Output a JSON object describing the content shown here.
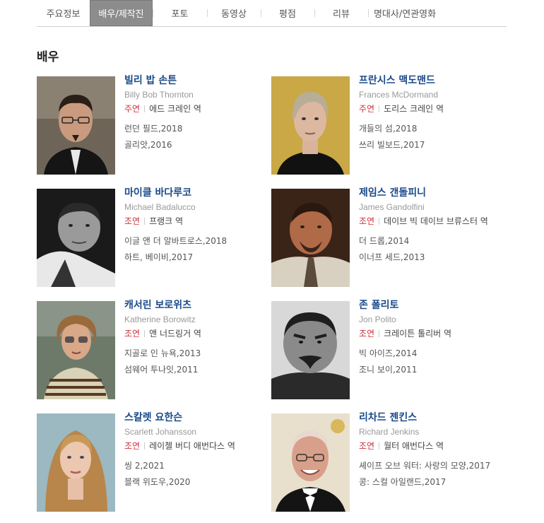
{
  "tabs": [
    {
      "label": "주요정보",
      "active": false
    },
    {
      "label": "배우/제작진",
      "active": true
    },
    {
      "label": "포토",
      "active": false
    },
    {
      "label": "동영상",
      "active": false
    },
    {
      "label": "평점",
      "active": false
    },
    {
      "label": "리뷰",
      "active": false
    },
    {
      "label": "명대사/연관영화",
      "active": false
    }
  ],
  "section_title": "배우",
  "actors": [
    {
      "name_ko": "빌리 밥 손튼",
      "name_en": "Billy Bob Thornton",
      "role": "주연",
      "character": "에드 크레인 역",
      "works": [
        "런던 필드,2018",
        "골리앗,2016"
      ],
      "photo": "portrait-billy-bob-thornton"
    },
    {
      "name_ko": "프란시스 맥도맨드",
      "name_en": "Frances McDormand",
      "role": "주연",
      "character": "도리스 크레인 역",
      "works": [
        "개들의 섬,2018",
        "쓰리 빌보드,2017"
      ],
      "photo": "portrait-frances-mcdormand"
    },
    {
      "name_ko": "마이클 바다루코",
      "name_en": "Michael Badalucco",
      "role": "조연",
      "character": "프랭크 역",
      "works": [
        "이글 앤 더 알바트로스,2018",
        "하트, 베이비,2017"
      ],
      "photo": "portrait-michael-badalucco"
    },
    {
      "name_ko": "제임스 갠돌피니",
      "name_en": "James Gandolfini",
      "role": "조연",
      "character": "데이브 빅 데이브 브류스터 역",
      "works": [
        "더 드롭,2014",
        "이너프 세드,2013"
      ],
      "photo": "portrait-james-gandolfini"
    },
    {
      "name_ko": "캐서린 보로위츠",
      "name_en": "Katherine Borowitz",
      "role": "조연",
      "character": "앤 너드링거 역",
      "works": [
        "지골로 인 뉴욕,2013",
        "섬웨어 투나잇,2011"
      ],
      "photo": "portrait-katherine-borowitz"
    },
    {
      "name_ko": "존 폴리토",
      "name_en": "Jon Polito",
      "role": "조연",
      "character": "크레이튼 톨리버 역",
      "works": [
        "빅 아이즈,2014",
        "조니 보이,2011"
      ],
      "photo": "portrait-jon-polito"
    },
    {
      "name_ko": "스칼렛 요한슨",
      "name_en": "Scarlett Johansson",
      "role": "조연",
      "character": "레이첼 버디 애번다스 역",
      "works": [
        "씽 2,2021",
        "블랙 위도우,2020"
      ],
      "photo": "portrait-scarlett-johansson"
    },
    {
      "name_ko": "리차드 젠킨스",
      "name_en": "Richard Jenkins",
      "role": "조연",
      "character": "월터 애번다스 역",
      "works": [
        "셰이프 오브 워터: 사랑의 모양,2017",
        "콩: 스컬 아일랜드,2017"
      ],
      "photo": "portrait-richard-jenkins"
    }
  ]
}
